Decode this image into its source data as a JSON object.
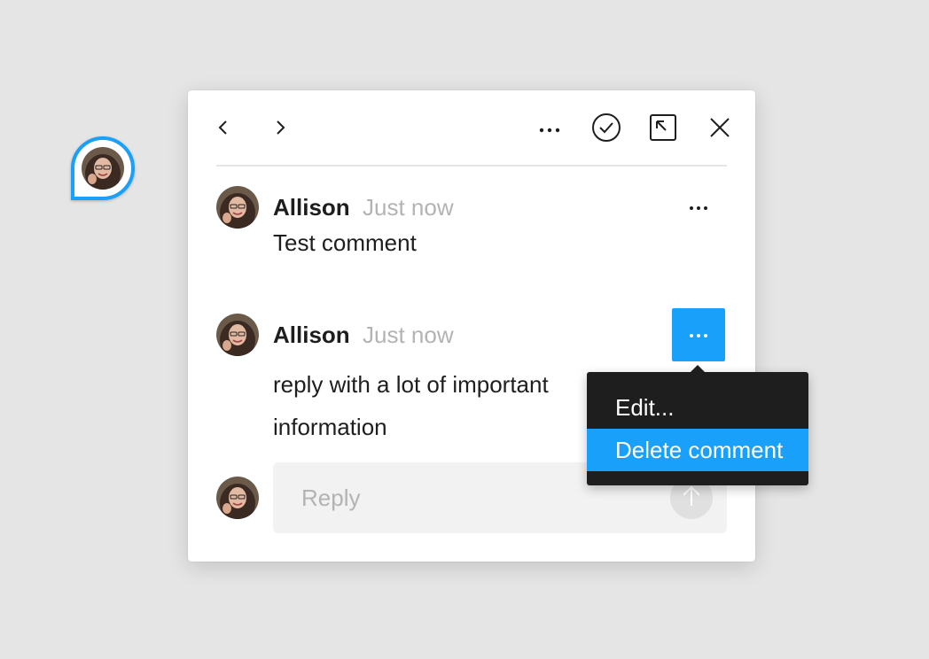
{
  "toolbar": {
    "prev_icon": "chevron-left-icon",
    "next_icon": "chevron-right-icon",
    "more_icon": "ellipsis-icon",
    "resolve_icon": "check-circle-icon",
    "pop_out_icon": "pop-out-icon",
    "close_icon": "close-icon"
  },
  "comments": [
    {
      "author": "Allison",
      "time": "Just now",
      "lines": [
        "Test comment"
      ],
      "menu_active": false
    },
    {
      "author": "Allison",
      "time": "Just now",
      "lines": [
        "reply with a lot of important",
        "information"
      ],
      "menu_active": true
    }
  ],
  "reply": {
    "placeholder": "Reply"
  },
  "context_menu": {
    "items": [
      {
        "label": "Edit...",
        "highlighted": false
      },
      {
        "label": "Delete comment",
        "highlighted": true
      }
    ]
  },
  "colors": {
    "accent": "#18a0fb",
    "menu_bg": "#1e1e1e",
    "text": "#1e1e1e",
    "muted": "#b3b3b3"
  }
}
